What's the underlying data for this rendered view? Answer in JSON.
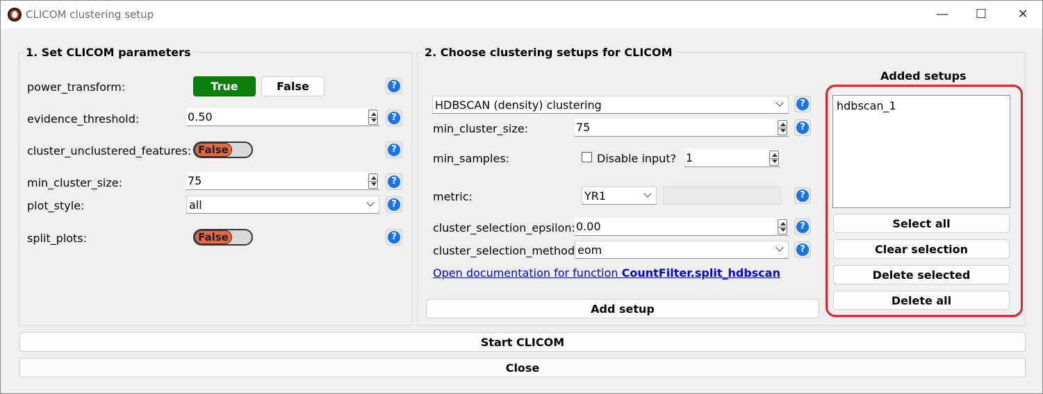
{
  "window": {
    "title": "CLICOM clustering setup",
    "minimize": "—",
    "maximize": "☐",
    "close": "✕"
  },
  "params": {
    "group_title": "1. Set CLICOM parameters",
    "power_transform_label": "power_transform:",
    "power_true": "True",
    "power_false": "False",
    "evidence_threshold_label": "evidence_threshold:",
    "evidence_threshold_value": "0.50",
    "cluster_unclustered_label": "cluster_unclustered_features:",
    "cluster_unclustered_toggle": "False",
    "min_cluster_size_label": "min_cluster_size:",
    "min_cluster_size_value": "75",
    "plot_style_label": "plot_style:",
    "plot_style_value": "all",
    "split_plots_label": "split_plots:",
    "split_plots_toggle": "False",
    "help_glyph": "?"
  },
  "setups": {
    "group_title": "2. Choose clustering setups for CLICOM",
    "method_value": "HDBSCAN (density) clustering",
    "min_cluster_size_label": "min_cluster_size:",
    "min_cluster_size_value": "75",
    "min_samples_label": "min_samples:",
    "disable_input_label": "Disable input?",
    "min_samples_value": "1",
    "metric_label": "metric:",
    "metric_value": "YR1",
    "epsilon_label": "cluster_selection_epsilon:",
    "epsilon_value": "0.00",
    "method_label": "cluster_selection_method:",
    "method_select_value": "eom",
    "doc_link_prefix": "Open documentation for function ",
    "doc_link_function": "CountFilter.split_hdbscan",
    "add_setup": "Add setup"
  },
  "added": {
    "title": "Added setups",
    "items": [
      "hdbscan_1"
    ],
    "select_all": "Select all",
    "clear_selection": "Clear selection",
    "delete_selected": "Delete selected",
    "delete_all": "Delete all"
  },
  "footer": {
    "start": "Start CLICOM",
    "close": "Close"
  },
  "colors": {
    "true_button": "#0a7e0a",
    "toggle_knob": "#e8683f",
    "help_icon": "#1a73e8",
    "highlight": "#e2222a",
    "link": "#0000ee"
  }
}
